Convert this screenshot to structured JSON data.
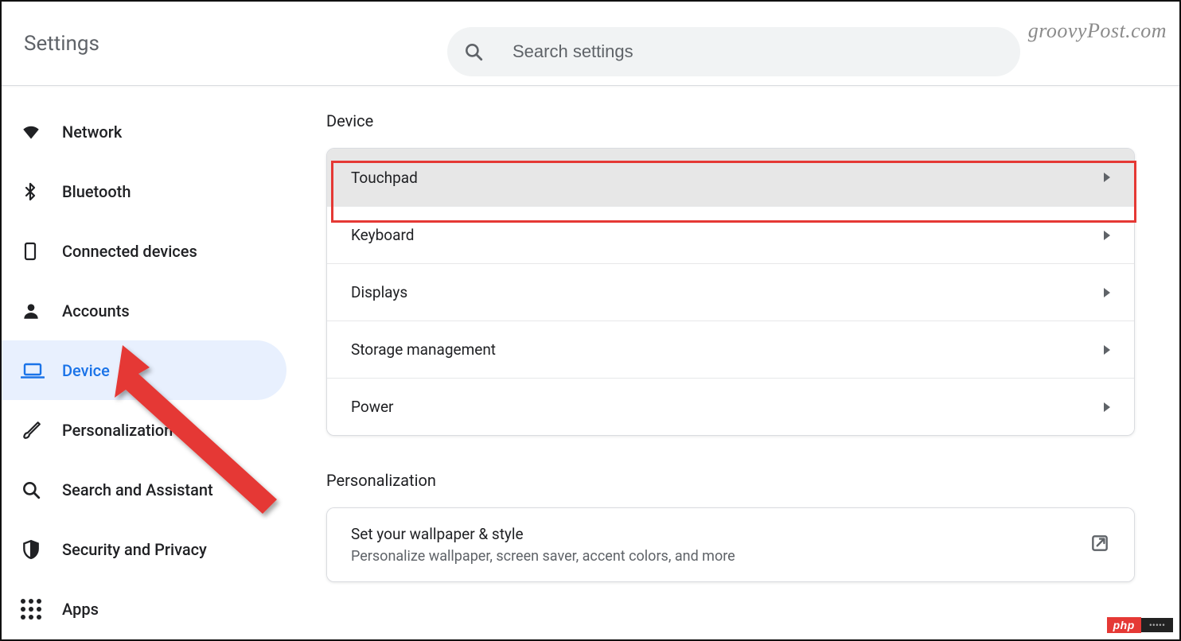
{
  "header": {
    "title": "Settings",
    "search_placeholder": "Search settings"
  },
  "watermark": "groovyPost.com",
  "sidebar": {
    "items": [
      {
        "label": "Network",
        "icon": "wifi-icon",
        "selected": false
      },
      {
        "label": "Bluetooth",
        "icon": "bluetooth-icon",
        "selected": false
      },
      {
        "label": "Connected devices",
        "icon": "device-icon",
        "selected": false
      },
      {
        "label": "Accounts",
        "icon": "person-icon",
        "selected": false
      },
      {
        "label": "Device",
        "icon": "laptop-icon",
        "selected": true
      },
      {
        "label": "Personalization",
        "icon": "brush-icon",
        "selected": false
      },
      {
        "label": "Search and Assistant",
        "icon": "search-icon",
        "selected": false
      },
      {
        "label": "Security and Privacy",
        "icon": "shield-icon",
        "selected": false
      },
      {
        "label": "Apps",
        "icon": "apps-icon",
        "selected": false
      }
    ]
  },
  "main": {
    "sections": [
      {
        "title": "Device",
        "rows": [
          {
            "label": "Touchpad",
            "highlighted": true
          },
          {
            "label": "Keyboard"
          },
          {
            "label": "Displays"
          },
          {
            "label": "Storage management"
          },
          {
            "label": "Power"
          }
        ]
      },
      {
        "title": "Personalization",
        "rows_sub": [
          {
            "title": "Set your wallpaper & style",
            "subtitle": "Personalize wallpaper, screen saver, accent colors, and more",
            "external": true
          }
        ]
      }
    ]
  },
  "badge": {
    "left": "php",
    "right": "•••••"
  }
}
